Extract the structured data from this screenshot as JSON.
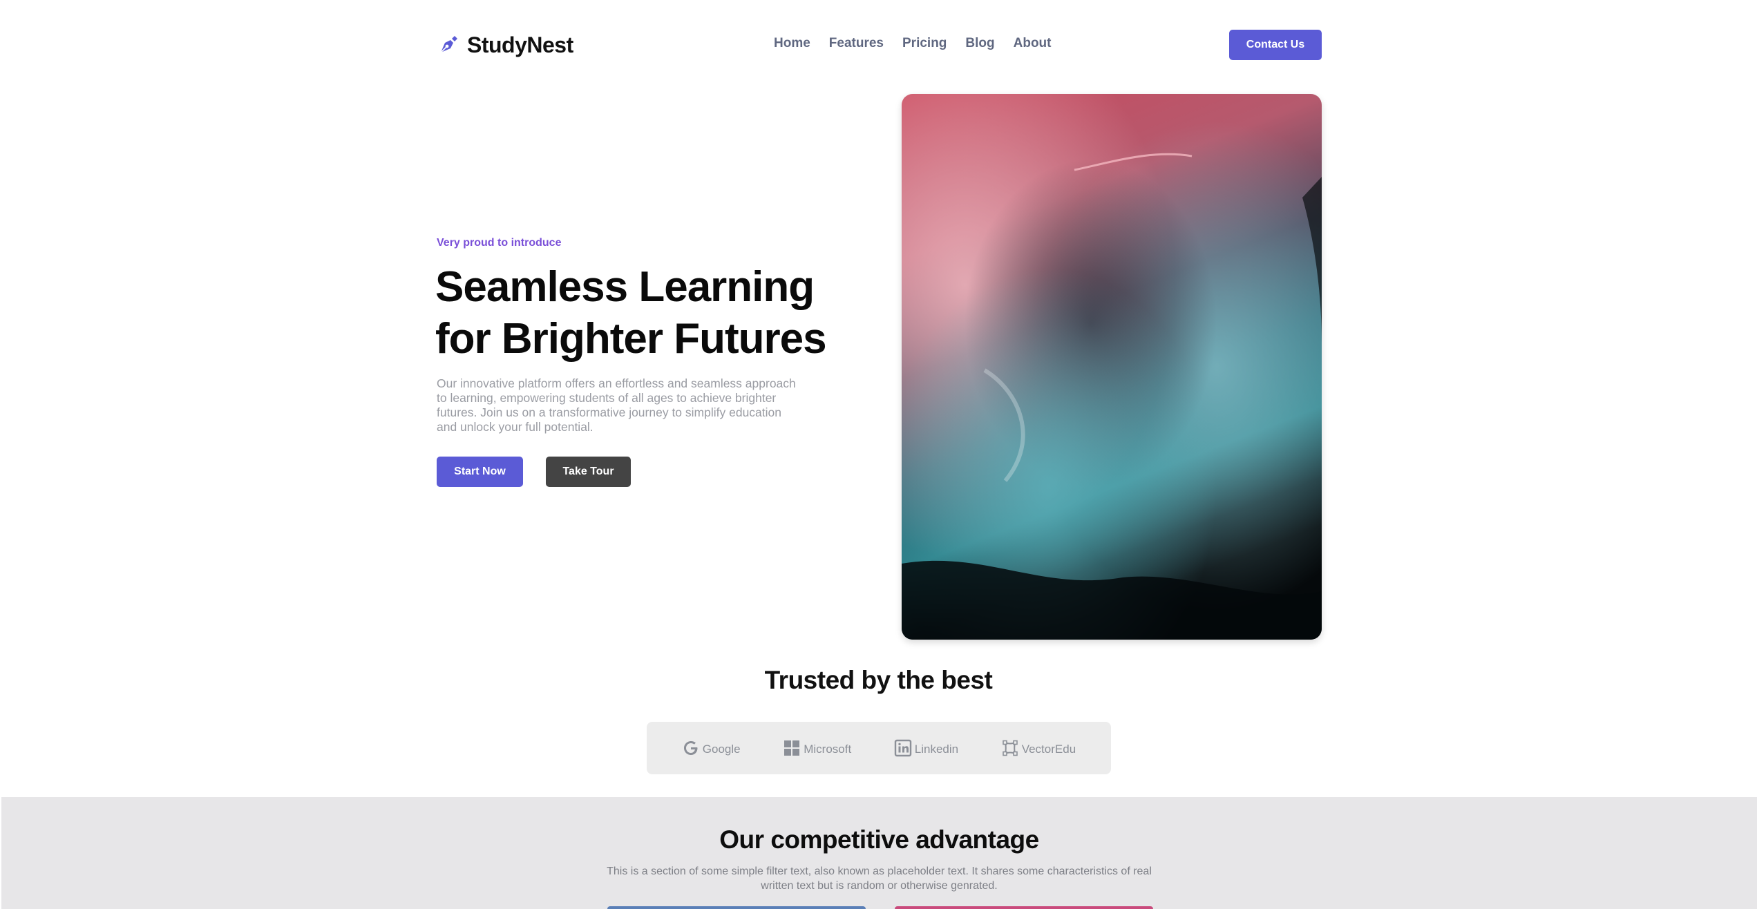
{
  "nav": {
    "brand": "StudyNest",
    "brand_icon": "pen-nib-icon",
    "items": [
      {
        "label": "Home"
      },
      {
        "label": "Features"
      },
      {
        "label": "Pricing"
      },
      {
        "label": "Blog"
      },
      {
        "label": "About"
      }
    ],
    "contact_label": "Contact Us"
  },
  "hero": {
    "eyebrow": "Very proud to introduce",
    "title_line1": "Seamless Learning",
    "title_line2": "for Brighter Futures",
    "description": "Our innovative platform offers an effortless and seamless approach to learning, empowering students of all ages to achieve brighter futures. Join us on a transformative journey to simplify education and unlock your full potential.",
    "start_label": "Start Now",
    "tour_label": "Take Tour",
    "image_icon": "abstract-fluid-art-image"
  },
  "trusted": {
    "title": "Trusted by the best",
    "logos": [
      {
        "label": "Google",
        "icon": "google-icon"
      },
      {
        "label": "Microsoft",
        "icon": "microsoft-icon"
      },
      {
        "label": "Linkedin",
        "icon": "linkedin-icon"
      },
      {
        "label": "VectorEdu",
        "icon": "vector-icon"
      }
    ]
  },
  "advantage": {
    "title": "Our competitive advantage",
    "description": "This is a section of some simple filter text, also known as placeholder text. It shares some characteristics of real written text but is random or otherwise genrated."
  },
  "colors": {
    "accent": "#5b5bd6",
    "eyebrow": "#7a4fd8",
    "dark_button": "#444444",
    "section_bg": "#e7e6e8"
  }
}
